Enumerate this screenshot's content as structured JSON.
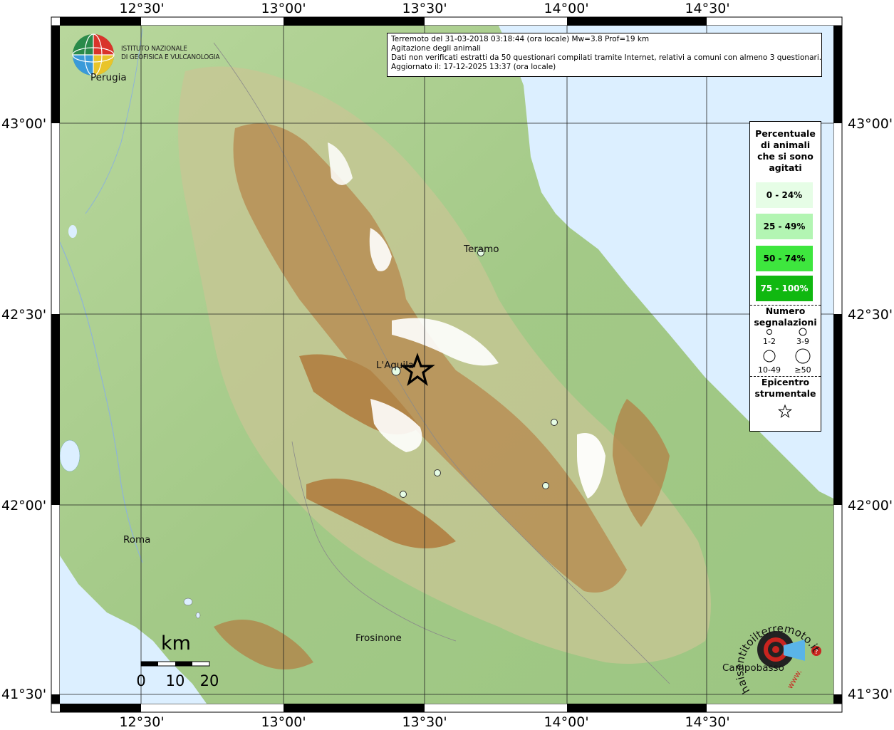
{
  "axes": {
    "top": [
      "12°30'",
      "13°00'",
      "13°30'",
      "14°00'",
      "14°30'"
    ],
    "bottom": [
      "12°30'",
      "13°00'",
      "13°30'",
      "14°00'",
      "14°30'"
    ],
    "left": [
      "43°00'",
      "42°30'",
      "42°00'",
      "41°30'"
    ],
    "right": [
      "43°00'",
      "42°30'",
      "42°00'",
      "41°30'"
    ]
  },
  "info": {
    "line1": "Terremoto del 31-03-2018 03:18:44 (ora locale) Mw=3.8 Prof=19 km",
    "line2": "Agitazione degli animali",
    "line3": "Dati non verificati estratti da 50 questionari compilati tramite Internet, relativi a comuni con almeno 3 questionari.",
    "line4": "Aggiornato il: 17-12-2025 13:37 (ora locale)"
  },
  "logo": {
    "line1": "ISTITUTO NAZIONALE",
    "line2": "DI GEOFISICA E VULCANOLOGIA"
  },
  "legend": {
    "title": [
      "Percentuale",
      "di animali",
      "che si sono",
      "agitati"
    ],
    "classes": [
      {
        "label": "0 - 24%",
        "color": "#e6fde6"
      },
      {
        "label": "25 - 49%",
        "color": "#b3f5b3"
      },
      {
        "label": "50 - 74%",
        "color": "#3ee63e"
      },
      {
        "label": "75 - 100%",
        "color": "#10b810"
      }
    ],
    "count_title": [
      "Numero",
      "segnalazioni"
    ],
    "sizes": [
      "1-2",
      "3-9",
      "10-49",
      "≥50"
    ],
    "epicenter_title": [
      "Epicentro",
      "strumentale"
    ]
  },
  "places": {
    "perugia": "Perugia",
    "teramo": "Teramo",
    "laquila": "L'Aquila",
    "roma": "Roma",
    "frosinone": "Frosinone",
    "campobasso": "Campobasso"
  },
  "scale": {
    "unit": "km",
    "ticks": [
      "0",
      "10",
      "20"
    ]
  },
  "stamp": {
    "text": "haisentitoilterremoto.it",
    "url": "www."
  },
  "colors": {
    "sea": "#dcefff",
    "lowland": "#a9cf8f",
    "hill": "#c9c793",
    "mountain": "#b58a4e",
    "peak": "#ffffff",
    "point": "#e6fde6"
  }
}
